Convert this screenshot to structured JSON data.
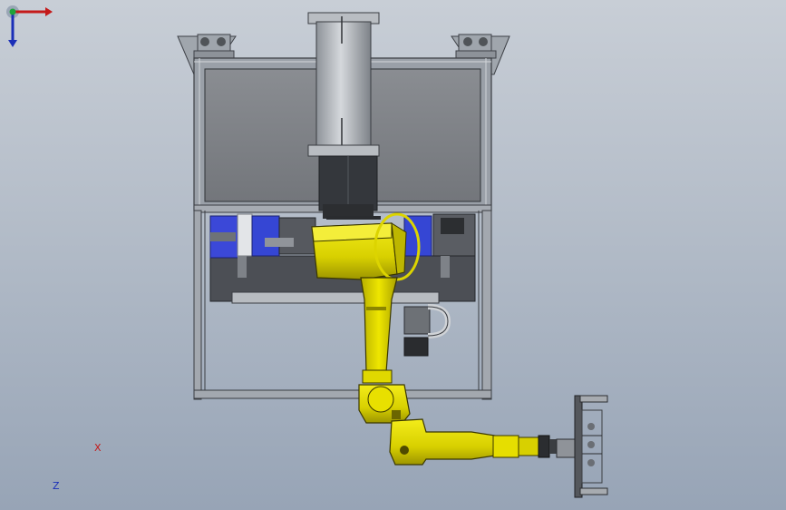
{
  "viewport": {
    "background_top": "#c8ced6",
    "background_bottom": "#97a4b6"
  },
  "triad": {
    "x_label": "X",
    "z_label": "Z",
    "x_color": "#c41a1a",
    "y_color": "#1ea33a",
    "z_color": "#1b2fb8"
  },
  "colors": {
    "robot": "#e6e000",
    "robot_shadow": "#b7b000",
    "frame": "#9aa0a8",
    "panel": "#7f8286",
    "drive_blue": "#3b48d8",
    "dark_base": "#4c4f55",
    "column": "#a7acb2"
  }
}
